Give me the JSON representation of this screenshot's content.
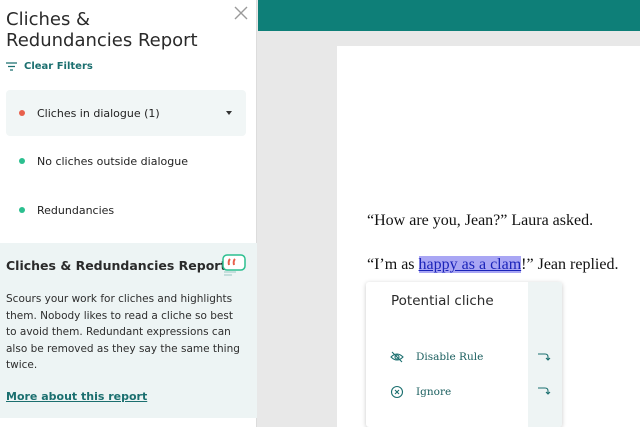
{
  "sidebar": {
    "title": "Cliches & Redundancies Report",
    "clear_filters_label": "Clear Filters",
    "rules": [
      {
        "label": "Cliches in dialogue (1)",
        "dot_color": "#e8604c",
        "active": true
      },
      {
        "label": "No cliches outside dialogue",
        "dot_color": "#2bbf8f",
        "active": false
      },
      {
        "label": "Redundancies",
        "dot_color": "#2bbf8f",
        "active": false
      }
    ],
    "info": {
      "heading": "Cliches & Redundancies Report",
      "description": "Scours your work for cliches and highlights them. Nobody likes to read a cliche so best to avoid them. Redundant expressions can also be removed as they say the same thing twice.",
      "link": "More about this report"
    }
  },
  "editor": {
    "line1": "“How are you, Jean?” Laura asked.",
    "line2_before": "“I’m as ",
    "line2_highlight": "happy as a clam",
    "line2_after": "!” Jean replied."
  },
  "popup": {
    "title": "Potential cliche",
    "actions": [
      {
        "label": "Disable Rule",
        "icon": "eye-off-icon"
      },
      {
        "label": "Ignore",
        "icon": "x-circle-icon"
      }
    ]
  },
  "colors": {
    "accent": "#0e7f78",
    "link": "#1b6f6f",
    "highlight": "#a9a6f4",
    "cliche_dot": "#e8604c",
    "ok_dot": "#2bbf8f"
  }
}
